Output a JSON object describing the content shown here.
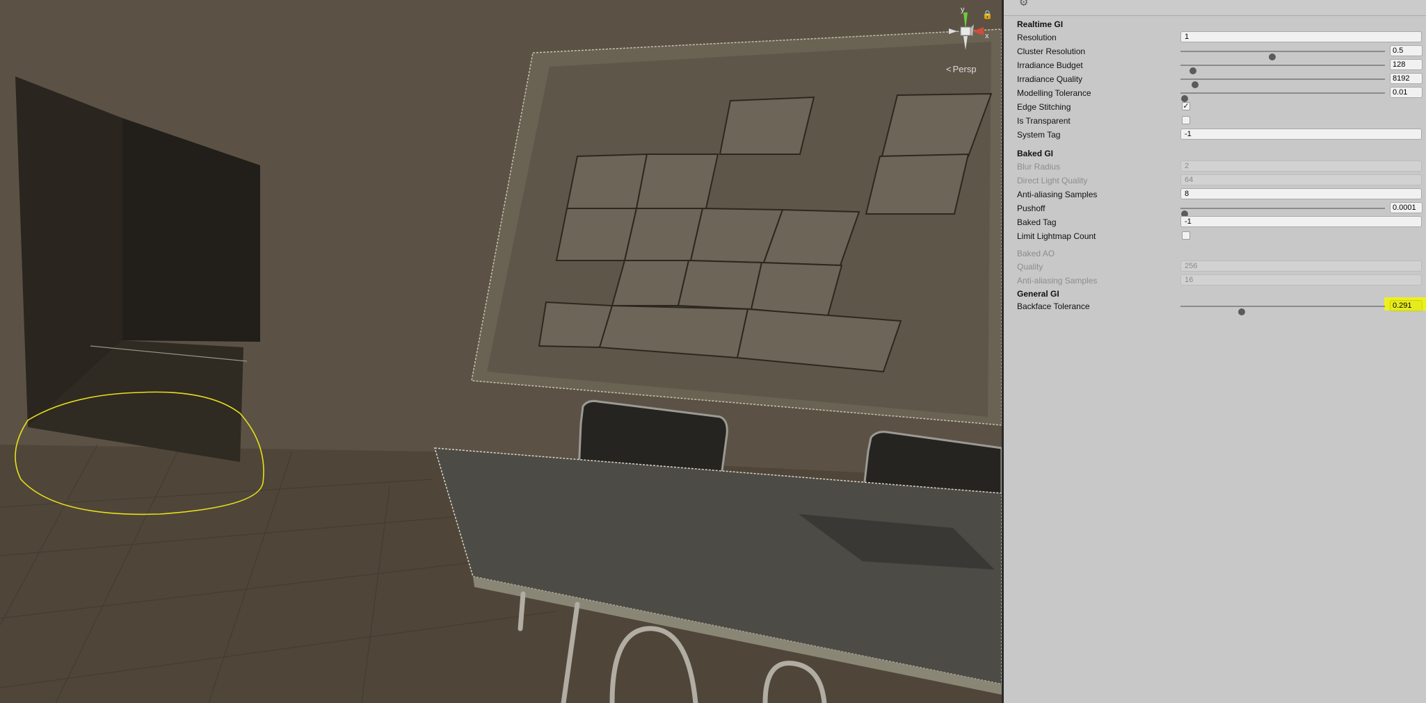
{
  "scene": {
    "gizmo": {
      "y_label": "y",
      "x_label": "x"
    },
    "view_mode": "Persp"
  },
  "inspector": {
    "realtime_gi": {
      "header": "Realtime GI",
      "resolution": {
        "label": "Resolution",
        "value": "1"
      },
      "cluster_resolution": {
        "label": "Cluster Resolution",
        "value": "0.5",
        "level": 0.45
      },
      "irradiance_budget": {
        "label": "Irradiance Budget",
        "value": "128",
        "level": 0.06
      },
      "irradiance_quality": {
        "label": "Irradiance Quality",
        "value": "8192",
        "level": 0.07
      },
      "modelling_tolerance": {
        "label": "Modelling Tolerance",
        "value": "0.01",
        "level": 0.02
      },
      "edge_stitching": {
        "label": "Edge Stitching",
        "checked": true
      },
      "is_transparent": {
        "label": "Is Transparent",
        "checked": false
      },
      "system_tag": {
        "label": "System Tag",
        "value": "-1"
      }
    },
    "baked_gi": {
      "header": "Baked GI",
      "blur_radius": {
        "label": "Blur Radius",
        "value": "2"
      },
      "direct_light_quality": {
        "label": "Direct Light Quality",
        "value": "64"
      },
      "anti_aliasing_samples": {
        "label": "Anti-aliasing Samples",
        "value": "8"
      },
      "pushoff": {
        "label": "Pushoff",
        "value": "0.0001",
        "level": 0.02
      },
      "baked_tag": {
        "label": "Baked Tag",
        "value": "-1"
      },
      "limit_lightmap_count": {
        "label": "Limit Lightmap Count",
        "checked": false
      }
    },
    "baked_ao": {
      "header": "Baked AO",
      "quality": {
        "label": "Quality",
        "value": "256"
      },
      "anti_aliasing_samples": {
        "label": "Anti-aliasing Samples",
        "value": "16"
      }
    },
    "general_gi": {
      "header": "General GI",
      "backface_tolerance": {
        "label": "Backface Tolerance",
        "value": "0.291",
        "level": 0.3
      }
    }
  },
  "colors": {
    "highlight": "#eef01e",
    "inspector_bg": "#c8c8c8",
    "annotation": "#e8e01a"
  }
}
